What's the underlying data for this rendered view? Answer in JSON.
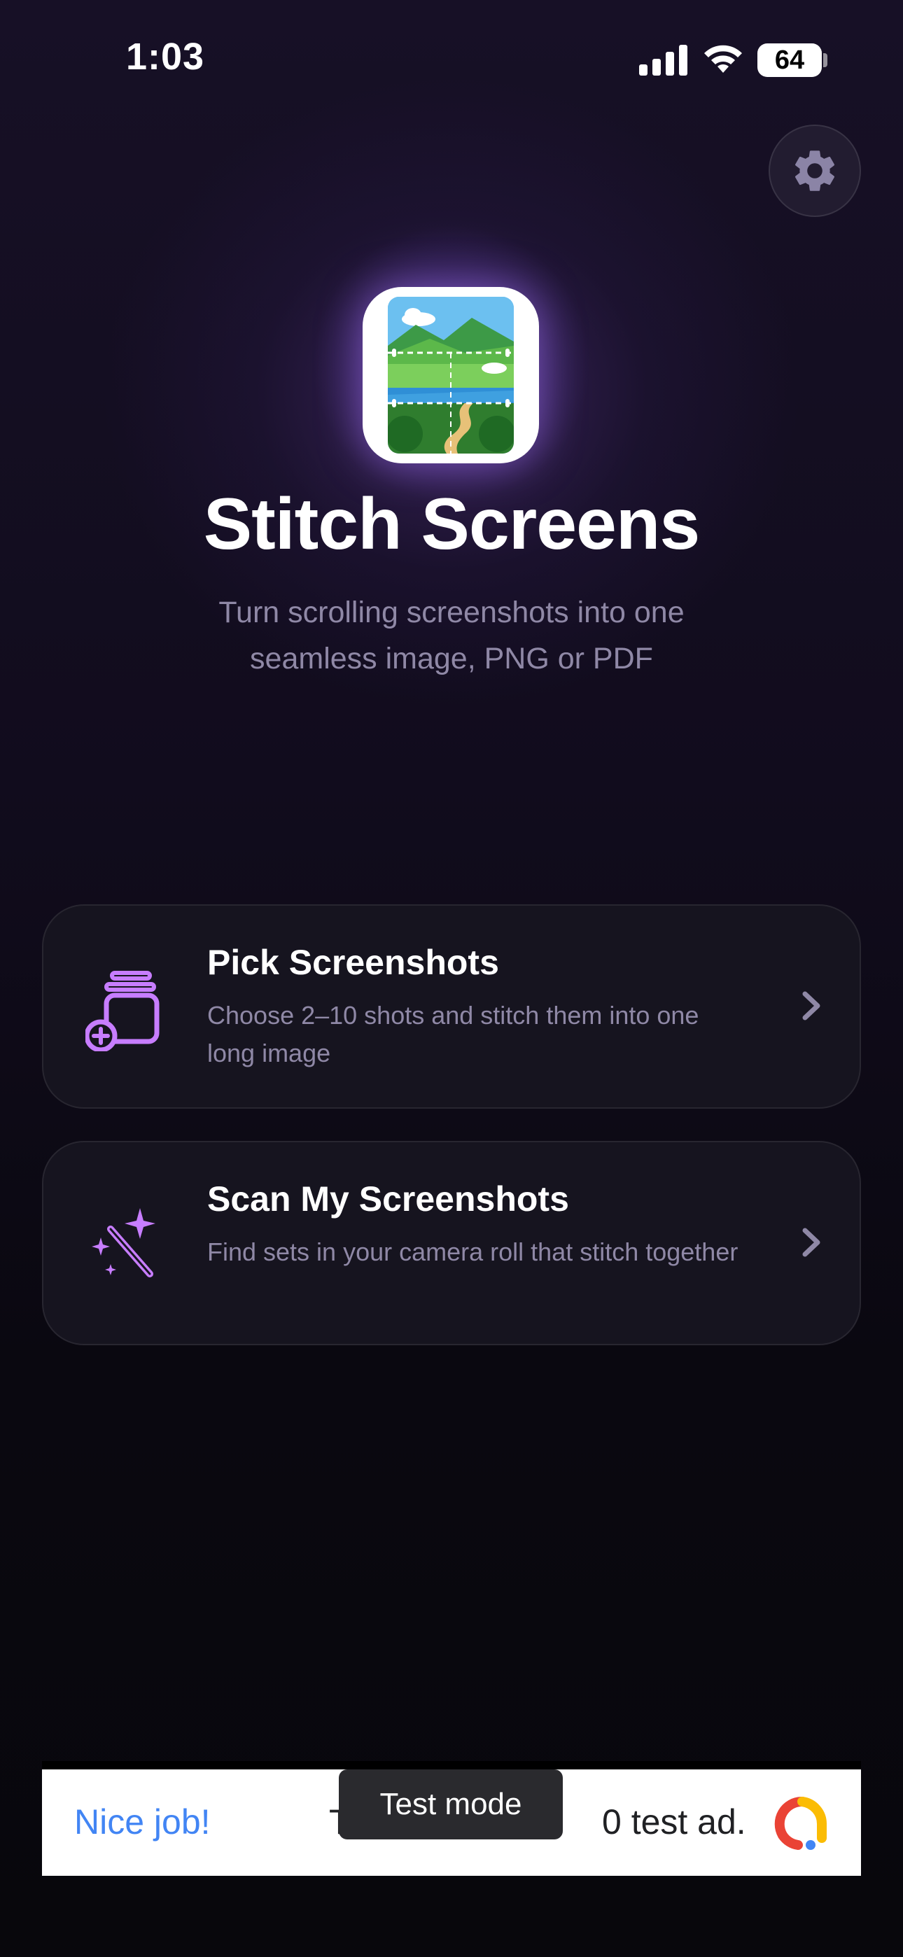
{
  "status_bar": {
    "time": "1:03",
    "battery_level": "64"
  },
  "header": {
    "settings_icon": "gear-icon"
  },
  "hero": {
    "app_icon": "stitched-landscape-icon",
    "title": "Stitch Screens",
    "subtitle": "Turn scrolling screenshots into one seamless image, PNG or PDF"
  },
  "actions": [
    {
      "icon": "add-stack-icon",
      "title": "Pick Screenshots",
      "description": "Choose 2–10 shots and stitch them into one long image"
    },
    {
      "icon": "magic-wand-icon",
      "title": "Scan My Screenshots",
      "description": "Find sets in your camera roll that stitch together"
    }
  ],
  "ad": {
    "headline": "Nice job!",
    "text_visible_left": "T",
    "text_visible_right": "0 test ad.",
    "badge": "Test mode",
    "logo_icon": "ad-logo-icon"
  },
  "colors": {
    "accent": "#c77dff",
    "background": "#0b0812",
    "card": "#16141f",
    "muted_text": "#8f88a6",
    "ad_link": "#4285f4"
  }
}
